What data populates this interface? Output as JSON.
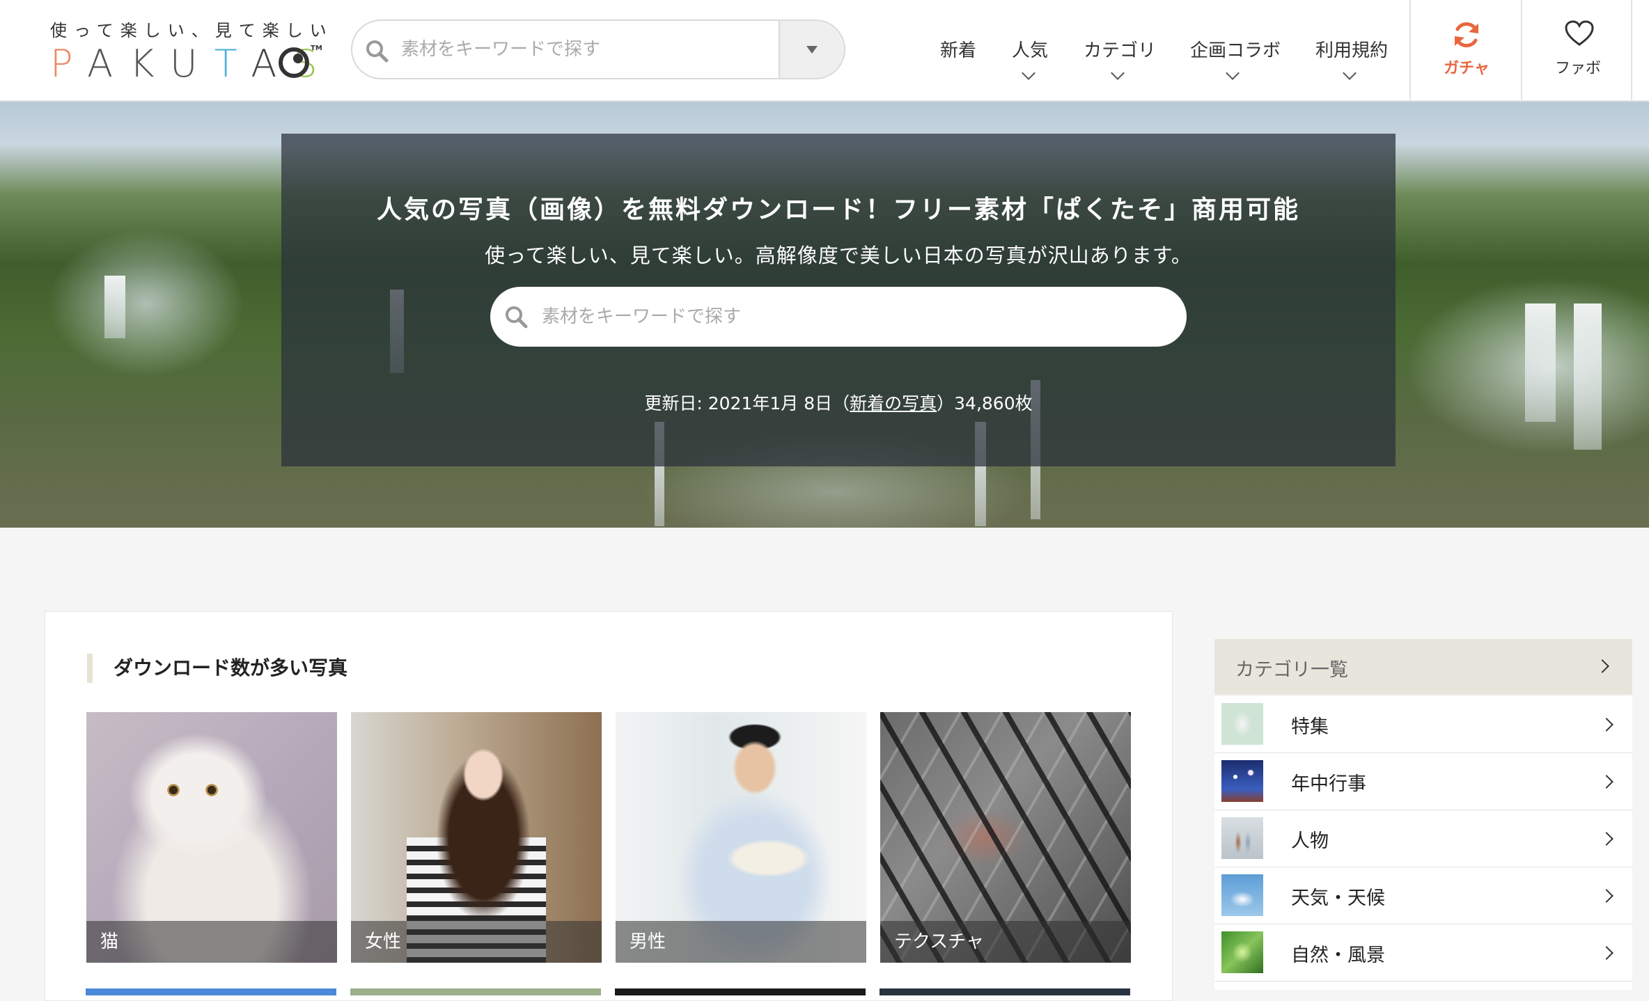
{
  "header": {
    "logo": {
      "tagline": "使って楽しい、見て楽しい",
      "wordmark": [
        "P",
        "A",
        "K",
        "U",
        "T",
        "A",
        "S"
      ],
      "tm": "TM"
    },
    "search": {
      "placeholder": "素材をキーワードで探す",
      "value": ""
    },
    "nav": [
      {
        "label": "新着",
        "has_dropdown": false
      },
      {
        "label": "人気",
        "has_dropdown": true
      },
      {
        "label": "カテゴリ",
        "has_dropdown": true
      },
      {
        "label": "企画コラボ",
        "has_dropdown": true
      },
      {
        "label": "利用規約",
        "has_dropdown": true
      }
    ],
    "gacha": {
      "label": "ガチャ",
      "icon": "refresh-icon",
      "color": "#e8663e"
    },
    "fav": {
      "label": "ファボ",
      "icon": "heart-icon"
    }
  },
  "hero": {
    "title": "人気の写真（画像）を無料ダウンロード！フリー素材「ぱくたそ」商用可能",
    "subtitle": "使って楽しい、見て楽しい。高解像度で美しい日本の写真が沢山あります。",
    "search": {
      "placeholder": "素材をキーワードで探す",
      "value": ""
    },
    "update_prefix": "更新日: 2021年1月 8日（",
    "update_link": "新着の写真",
    "update_suffix": "）34,860枚"
  },
  "popular": {
    "title": "ダウンロード数が多い写真",
    "photos": [
      {
        "caption": "猫"
      },
      {
        "caption": "女性"
      },
      {
        "caption": "男性"
      },
      {
        "caption": "テクスチャ"
      }
    ]
  },
  "sidebar": {
    "heading": "カテゴリ一覧",
    "items": [
      {
        "label": "特集"
      },
      {
        "label": "年中行事"
      },
      {
        "label": "人物"
      },
      {
        "label": "天気・天候"
      },
      {
        "label": "自然・風景"
      }
    ]
  },
  "colors": {
    "accent_orange": "#e8663e",
    "sidebar_header_bg": "#e8e6dc",
    "hero_panel": "rgba(40,48,58,0.72)"
  }
}
